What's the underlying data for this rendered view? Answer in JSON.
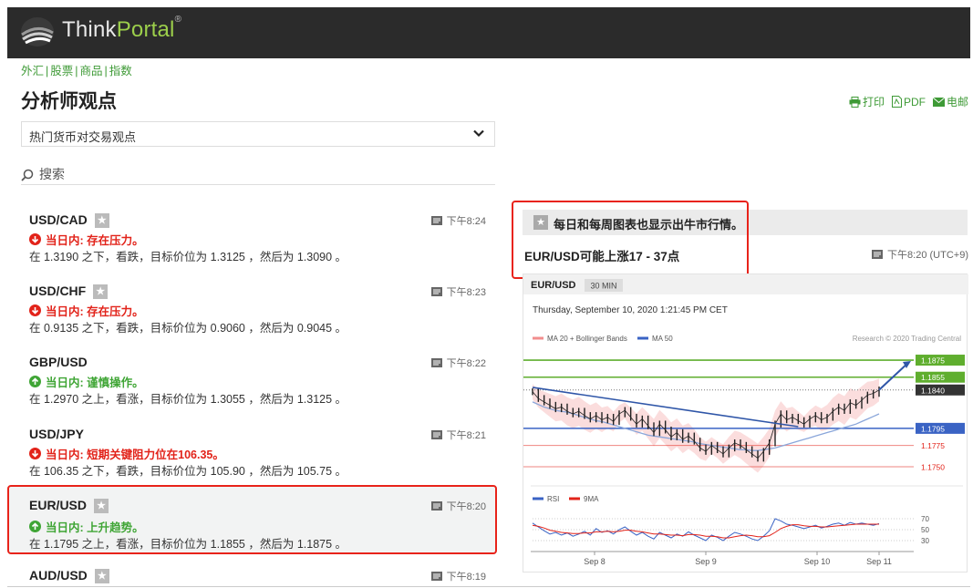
{
  "brand": {
    "name_a": "Think",
    "name_b": "Portal",
    "mark": "®"
  },
  "nav": [
    "外汇",
    "股票",
    "商品",
    "指数"
  ],
  "page_title": "分析师观点",
  "actions": {
    "print": "打印",
    "pdf": "PDF",
    "email": "电邮"
  },
  "dropdown": {
    "selected": "热门货币对交易观点"
  },
  "search": {
    "label": "搜索"
  },
  "items": [
    {
      "pair": "USD/CAD",
      "time": "下午8:24",
      "trend": "down",
      "status": "当日内: 存在压力。",
      "desc": "在 1.3190 之下，看跌，目标价位为 1.3125 ，然后为 1.3090 。"
    },
    {
      "pair": "USD/CHF",
      "time": "下午8:23",
      "trend": "down",
      "status": "当日内: 存在压力。",
      "desc": "在 0.9135 之下，看跌，目标价位为 0.9060 ，然后为 0.9045 。"
    },
    {
      "pair": "GBP/USD",
      "time": "下午8:22",
      "trend": "up",
      "status": "当日内: 谨慎操作。",
      "desc": "在 1.2970 之上，看涨，目标价位为 1.3055 ，然后为 1.3125 。"
    },
    {
      "pair": "USD/JPY",
      "time": "下午8:21",
      "trend": "down",
      "status": "当日内: 短期关键阻力位在106.35。",
      "desc": "在 106.35 之下，看跌，目标价位为 105.90 ，然后为 105.75 。"
    },
    {
      "pair": "EUR/USD",
      "time": "下午8:20",
      "trend": "up",
      "status": "当日内: 上升趋势。",
      "desc": "在 1.1795 之上，看涨，目标价位为 1.1855 ，然后为 1.1875 。"
    },
    {
      "pair": "AUD/USD",
      "time": "下午8:19",
      "trend": "",
      "status": "",
      "desc": ""
    }
  ],
  "right_panel": {
    "header": "每日和每周图表也显示出牛市行情。",
    "title": "EUR/USD可能上涨17 - 37点",
    "time": "下午8:20 (UTC+9)"
  },
  "chart_data": {
    "type": "line",
    "symbol": "EUR/USD",
    "interval": "30 MIN",
    "timestamp": "Thursday, September 10, 2020 1:21:45 PM CET",
    "legend": [
      "MA 20 + Bollinger Bands",
      "MA 50"
    ],
    "credit": "Research © 2020 Trading Central",
    "price_levels": [
      {
        "label": "1.1875",
        "value": 1.1875,
        "color": "#5fae2e"
      },
      {
        "label": "1.1855",
        "value": 1.1855,
        "color": "#5fae2e"
      },
      {
        "label": "1.1840",
        "value": 1.184,
        "color": "#333333"
      },
      {
        "label": "1.1795",
        "value": 1.1795,
        "color": "#3a63c4"
      },
      {
        "label": "1.1775",
        "value": 1.1775,
        "color": "#e2231a"
      },
      {
        "label": "1.1750",
        "value": 1.175,
        "color": "#e2231a"
      }
    ],
    "ylim": [
      1.1735,
      1.189
    ],
    "x_labels": [
      "Sep 8",
      "Sep 9",
      "Sep 10",
      "Sep 11"
    ],
    "price": [
      1.1838,
      1.183,
      1.1826,
      1.1822,
      1.1818,
      1.182,
      1.1815,
      1.1812,
      1.1815,
      1.181,
      1.1806,
      1.181,
      1.1805,
      1.1808,
      1.1803,
      1.1812,
      1.1816,
      1.1808,
      1.18,
      1.1806,
      1.1798,
      1.179,
      1.18,
      1.1793,
      1.1785,
      1.179,
      1.1782,
      1.1786,
      1.178,
      1.1772,
      1.1768,
      1.1775,
      1.177,
      1.1765,
      1.1772,
      1.1778,
      1.1775,
      1.177,
      1.1765,
      1.176,
      1.1768,
      1.1778,
      1.18,
      1.1812,
      1.1805,
      1.1808,
      1.1804,
      1.18,
      1.1806,
      1.181,
      1.1805,
      1.1808,
      1.1815,
      1.182,
      1.1816,
      1.1825,
      1.1822,
      1.1828,
      1.1834,
      1.1836,
      1.184
    ],
    "ma50": [
      1.1826,
      1.1823,
      1.182,
      1.1818,
      1.1816,
      1.1815,
      1.1814,
      1.1812,
      1.181,
      1.1808,
      1.1806,
      1.1804,
      1.1803,
      1.1801,
      1.1799,
      1.1797,
      1.1795,
      1.1793,
      1.1791,
      1.1789,
      1.1787,
      1.1786,
      1.1785,
      1.1784,
      1.1783,
      1.1782,
      1.1781,
      1.178,
      1.1779,
      1.1777,
      1.1776,
      1.1775,
      1.1774,
      1.1773,
      1.1772,
      1.1771,
      1.177,
      1.177,
      1.1769,
      1.1769,
      1.177,
      1.1771,
      1.1772,
      1.1774,
      1.1776,
      1.1778,
      1.178,
      1.1782,
      1.1784,
      1.1786,
      1.1788,
      1.179,
      1.1792,
      1.1794,
      1.1796,
      1.1798,
      1.18,
      1.1803,
      1.1806,
      1.1809,
      1.1812
    ],
    "rsi_levels": [
      "70",
      "50",
      "30"
    ],
    "rsi_legend": [
      "RSI",
      "9MA"
    ],
    "rsi": [
      62,
      55,
      48,
      42,
      45,
      40,
      44,
      38,
      42,
      47,
      40,
      52,
      45,
      48,
      42,
      50,
      55,
      47,
      40,
      45,
      38,
      33,
      45,
      40,
      35,
      42,
      38,
      46,
      40,
      35,
      30,
      40,
      36,
      30,
      38,
      45,
      42,
      38,
      33,
      30,
      38,
      48,
      70,
      66,
      60,
      58,
      55,
      52,
      55,
      58,
      53,
      56,
      60,
      62,
      58,
      63,
      60,
      62,
      60,
      58,
      61
    ],
    "rsi_ma": [
      58,
      56,
      53,
      49,
      47,
      45,
      44,
      43,
      43,
      44,
      44,
      46,
      46,
      47,
      46,
      47,
      49,
      49,
      47,
      46,
      44,
      42,
      42,
      41,
      40,
      40,
      39,
      41,
      41,
      40,
      38,
      38,
      37,
      35,
      35,
      37,
      39,
      40,
      39,
      37,
      37,
      39,
      45,
      52,
      56,
      59,
      59,
      57,
      56,
      56,
      55,
      55,
      56,
      57,
      58,
      59,
      60,
      60,
      60,
      60,
      60
    ]
  }
}
